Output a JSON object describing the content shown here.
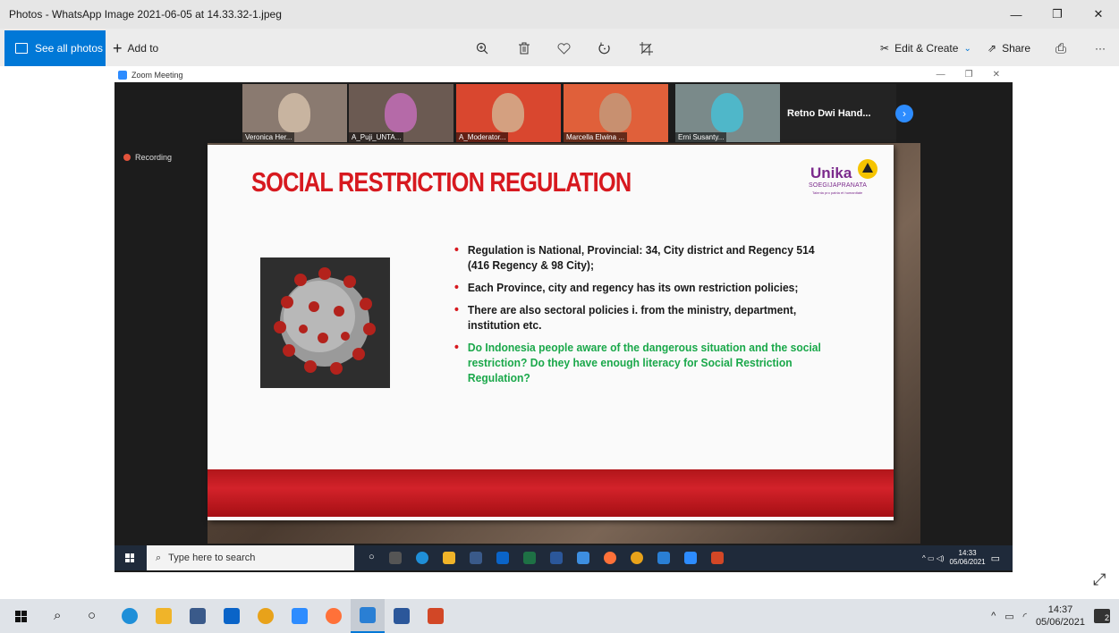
{
  "window": {
    "title": "Photos - WhatsApp Image 2021-06-05 at 14.33.32-1.jpeg",
    "minimize": "—",
    "restore": "❐",
    "close": "✕"
  },
  "toolbar": {
    "see_all": "See all photos",
    "add_to": "Add to",
    "edit_create": "Edit & Create",
    "share": "Share",
    "more": "···"
  },
  "zoom": {
    "window_title": "Zoom Meeting",
    "min": "—",
    "restore": "❐",
    "close": "✕",
    "participants": [
      {
        "name": "Veronica Her...",
        "bg": "#8a7a70",
        "face": "#c8b4a0"
      },
      {
        "name": "A_Puji_UNTA...",
        "bg": "#6b5a52",
        "face": "#b56aa8"
      },
      {
        "name": "A_Moderator...",
        "bg": "#d9472f",
        "face": "#d4a080"
      },
      {
        "name": "Marcella Elwina ...",
        "bg": "#e0603a",
        "face": "#c89070"
      },
      {
        "name": "Erni Susanty...",
        "bg": "#7a8a8a",
        "face": "#4fb7c9"
      }
    ],
    "featured_name": "Retno Dwi Hand...",
    "recording": "Recording"
  },
  "slide": {
    "title": "SOCIAL RESTRICTION REGULATION",
    "logo_main": "Unika",
    "logo_sub": "SOEGIJAPRANATA",
    "logo_tagline": "Talenta pro patria et humanitate",
    "bullets": [
      {
        "text": "Regulation is National, Provincial: 34, City district and Regency 514 (416 Regency & 98 City);",
        "color": "black"
      },
      {
        "text": "Each Province, city and regency has its own restriction policies;",
        "color": "black"
      },
      {
        "text": "There are also sectoral policies i. from the ministry, department, institution etc.",
        "color": "black"
      },
      {
        "text": "Do Indonesia people aware of the dangerous situation and the social restriction? Do they have enough literacy for Social Restriction Regulation?",
        "color": "green"
      }
    ]
  },
  "inner_taskbar": {
    "search_placeholder": "Type here to search",
    "time": "14:33",
    "date": "05/06/2021"
  },
  "taskbar": {
    "time": "14:37",
    "date": "05/06/2021",
    "notification_count": "2",
    "apps": [
      {
        "name": "search-icon",
        "color": "transparent"
      },
      {
        "name": "cortana-icon",
        "color": "transparent"
      },
      {
        "name": "edge-icon",
        "color": "#1f8fd8"
      },
      {
        "name": "file-explorer-icon",
        "color": "#f0b429"
      },
      {
        "name": "store-icon",
        "color": "#3a5a8a"
      },
      {
        "name": "mail-icon",
        "color": "#0a64c8"
      },
      {
        "name": "chrome-icon",
        "color": "#e8a21a"
      },
      {
        "name": "zoom-icon",
        "color": "#2d8cff"
      },
      {
        "name": "firefox-icon",
        "color": "#ff7139"
      },
      {
        "name": "photos-icon",
        "color": "#2a7fd4"
      },
      {
        "name": "word-icon",
        "color": "#2b579a"
      },
      {
        "name": "powerpoint-icon",
        "color": "#d24726"
      }
    ]
  }
}
